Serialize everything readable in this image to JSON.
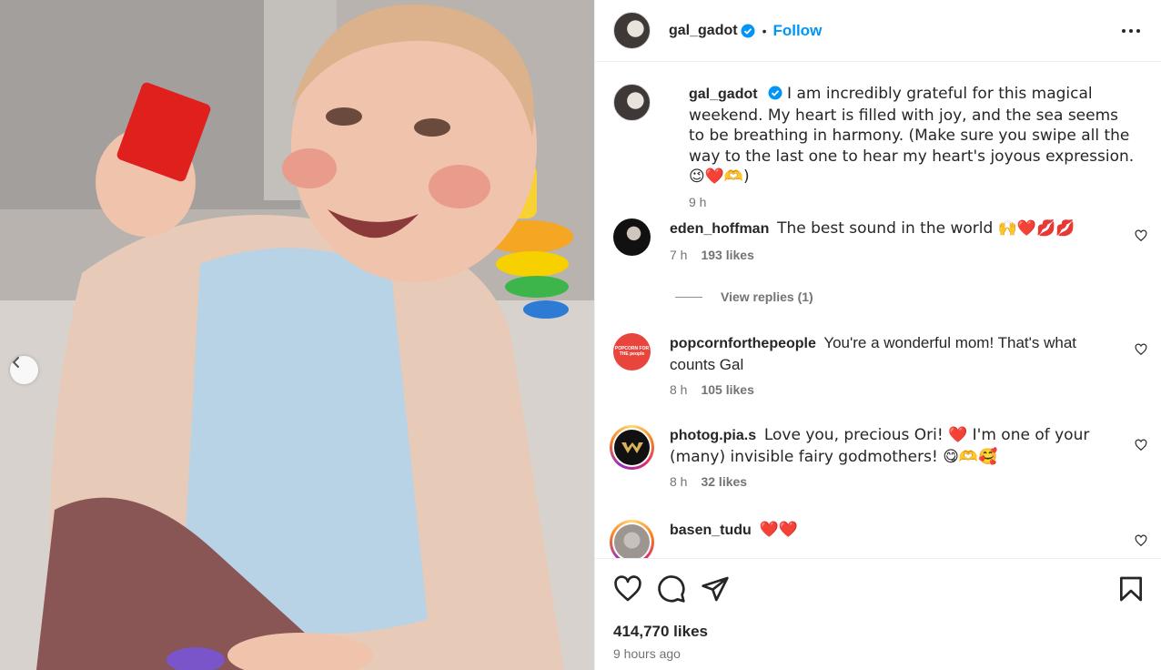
{
  "post": {
    "author": "gal_gadot",
    "follow_label": "Follow",
    "separator": "•",
    "caption": "I am incredibly grateful for this magical weekend. My heart is filled with joy, and the sea seems to be breathing in harmony. (Make sure you swipe all the way to the last one to hear my heart's joyous expression. 😉❤️🫶)",
    "caption_time": "9 h",
    "likes": "414,770 likes",
    "time_ago": "9 hours ago"
  },
  "comments": [
    {
      "user": "eden_hoffman",
      "text": "The best sound in the world 🙌❤️💋💋",
      "time": "7 h",
      "likes": "193 likes",
      "view_replies": "View replies (1)"
    },
    {
      "user": "popcornforthepeople",
      "text": "You're a wonderful mom! That's what counts Gal",
      "time": "8 h",
      "likes": "105 likes",
      "avatar_text": "POPCORN FOR THE people"
    },
    {
      "user": "photog.pia.s",
      "text": "Love you, precious Ori! ❤️ I'm one of your (many) invisible fairy godmothers! 😋🫶🥰",
      "time": "8 h",
      "likes": "32 likes"
    },
    {
      "user": "basen_tudu",
      "text": "❤️❤️"
    }
  ],
  "icons": {
    "prev": "chevron-left-icon",
    "more": "more-options-icon",
    "verified": "verified-badge-icon",
    "like": "heart-icon",
    "comment": "comment-icon",
    "share": "share-icon",
    "save": "bookmark-icon"
  },
  "colors": {
    "link": "#0095f6",
    "verified": "#0095f6",
    "muted": "#737373"
  }
}
